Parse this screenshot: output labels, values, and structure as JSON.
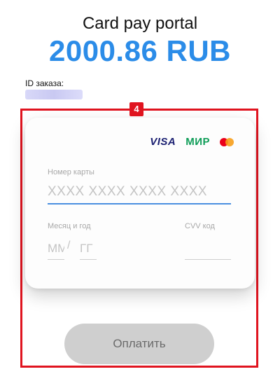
{
  "header": {
    "title": "Card pay portal",
    "amount": "2000.86 RUB"
  },
  "order": {
    "label": "ID заказа:"
  },
  "highlight": {
    "badge": "4",
    "color": "#e0141f"
  },
  "card_form": {
    "brands": {
      "visa": "VISA",
      "mir": "МИР",
      "mastercard_icon": "mastercard-logo-icon"
    },
    "card_number": {
      "label": "Номер карты",
      "placeholder": "XXXX XXXX XXXX XXXX"
    },
    "expiry": {
      "label": "Месяц и год",
      "month_placeholder": "ММ",
      "separator": "/",
      "year_placeholder": "ГГ"
    },
    "cvv": {
      "label": "CVV код"
    }
  },
  "pay_button": {
    "label": "Оплатить"
  },
  "colors": {
    "amount": "#2b8ce8",
    "focus_underline": "#4a8fe0",
    "button_bg": "#cfcfcf"
  }
}
